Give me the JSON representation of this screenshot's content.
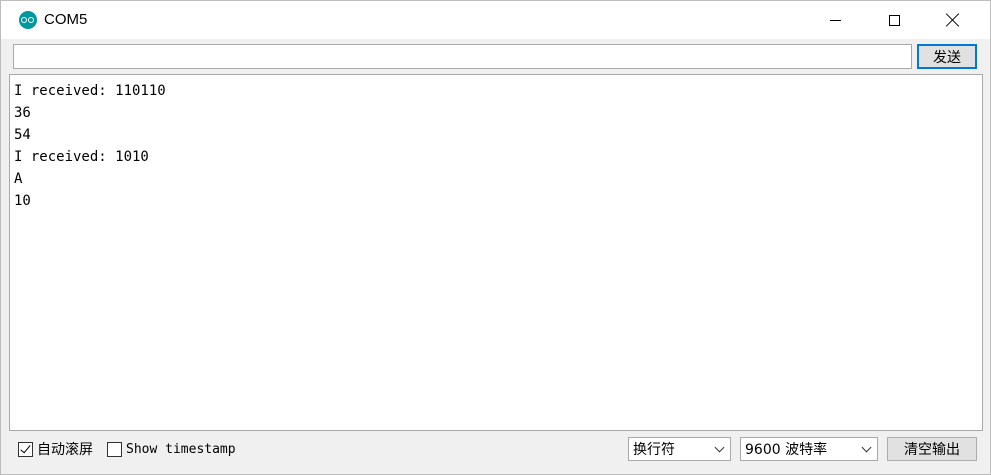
{
  "window": {
    "title": "COM5",
    "icon": "arduino-icon"
  },
  "send": {
    "input_value": "",
    "button_label": "发送"
  },
  "output": {
    "lines": [
      "I received: 110110",
      "36",
      "54",
      "I received: 1010",
      "A",
      "10"
    ]
  },
  "footer": {
    "autoscroll_label": "自动滚屏",
    "autoscroll_checked": true,
    "timestamp_label": "Show timestamp",
    "timestamp_checked": false,
    "line_ending_value": "换行符",
    "baud_value": "9600 波特率",
    "clear_label": "清空输出"
  },
  "colors": {
    "accent": "#0078d7",
    "icon": "#00979d"
  }
}
